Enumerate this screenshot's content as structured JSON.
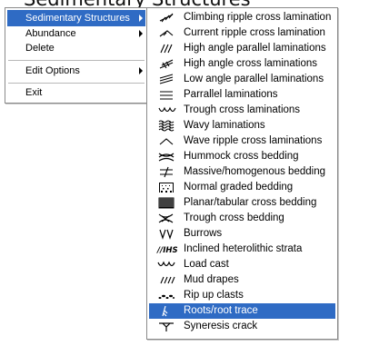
{
  "top_strip_text": "Sedimentary Structures",
  "menu": {
    "items": [
      {
        "label": "Sedimentary Structures",
        "has_submenu": true,
        "highlighted": true
      },
      {
        "label": "Abundance",
        "has_submenu": true,
        "highlighted": false
      },
      {
        "label": "Delete",
        "has_submenu": false,
        "highlighted": false
      },
      {
        "label": "Edit Options",
        "has_submenu": true,
        "highlighted": false
      },
      {
        "label": "Exit",
        "has_submenu": false,
        "highlighted": false
      }
    ]
  },
  "submenu": {
    "items": [
      {
        "label": "Climbing ripple cross lamination",
        "icon": "climbing-ripple-icon"
      },
      {
        "label": "Current ripple cross lamination",
        "icon": "current-ripple-icon"
      },
      {
        "label": "High angle parallel laminations",
        "icon": "high-angle-parallel-icon"
      },
      {
        "label": "High angle cross laminations",
        "icon": "high-angle-cross-icon"
      },
      {
        "label": "Low angle parallel laminations",
        "icon": "low-angle-parallel-icon"
      },
      {
        "label": "Parrallel laminations",
        "icon": "parallel-laminations-icon"
      },
      {
        "label": "Trough cross laminations",
        "icon": "trough-cross-lamination-icon"
      },
      {
        "label": "Wavy laminations",
        "icon": "wavy-laminations-icon"
      },
      {
        "label": "Wave ripple cross laminations",
        "icon": "wave-ripple-icon"
      },
      {
        "label": "Hummock cross bedding",
        "icon": "hummock-icon"
      },
      {
        "label": "Massive/homogenous bedding",
        "icon": "massive-bedding-icon"
      },
      {
        "label": "Normal graded bedding",
        "icon": "graded-bedding-icon"
      },
      {
        "label": "Planar/tabular cross bedding",
        "icon": "planar-cross-bedding-icon"
      },
      {
        "label": "Trough cross bedding",
        "icon": "trough-cross-bedding-icon"
      },
      {
        "label": "Burrows",
        "icon": "burrows-icon"
      },
      {
        "label": "Inclined heterolithic strata",
        "icon": "ihs-icon",
        "icon_text": "//IHS"
      },
      {
        "label": "Load cast",
        "icon": "load-cast-icon"
      },
      {
        "label": "Mud drapes",
        "icon": "mud-drapes-icon"
      },
      {
        "label": "Rip up clasts",
        "icon": "rip-up-clasts-icon"
      },
      {
        "label": "Roots/root trace",
        "icon": "roots-icon",
        "highlighted": true
      },
      {
        "label": "Syneresis crack",
        "icon": "syneresis-crack-icon"
      }
    ]
  },
  "colors": {
    "highlight": "#2f6bc4",
    "highlight_text": "#ffffff",
    "menu_border": "#8a8a8a"
  }
}
